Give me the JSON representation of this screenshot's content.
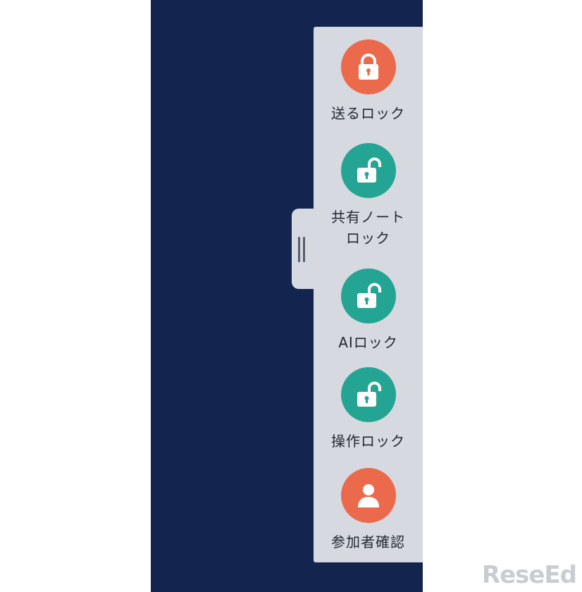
{
  "panel": {
    "items": [
      {
        "label": "送るロック",
        "state": "locked",
        "color": "#ec6a4c",
        "icon": "lock-closed-icon"
      },
      {
        "label": "共有ノートロック",
        "state": "unlocked",
        "color": "#24a594",
        "icon": "lock-open-icon"
      },
      {
        "label": "AIロック",
        "state": "unlocked",
        "color": "#24a594",
        "icon": "lock-open-icon"
      },
      {
        "label": "操作ロック",
        "state": "unlocked",
        "color": "#24a594",
        "icon": "lock-open-icon"
      },
      {
        "label": "参加者確認",
        "state": "action",
        "color": "#ec6a4c",
        "icon": "person-icon"
      }
    ]
  },
  "handle": {
    "icon": "drag-handle-icon"
  },
  "colors": {
    "background": "#13254f",
    "panel": "#d6d9e0",
    "locked": "#ec6a4c",
    "unlocked": "#24a594"
  },
  "watermark": {
    "text": "ReseEd"
  }
}
